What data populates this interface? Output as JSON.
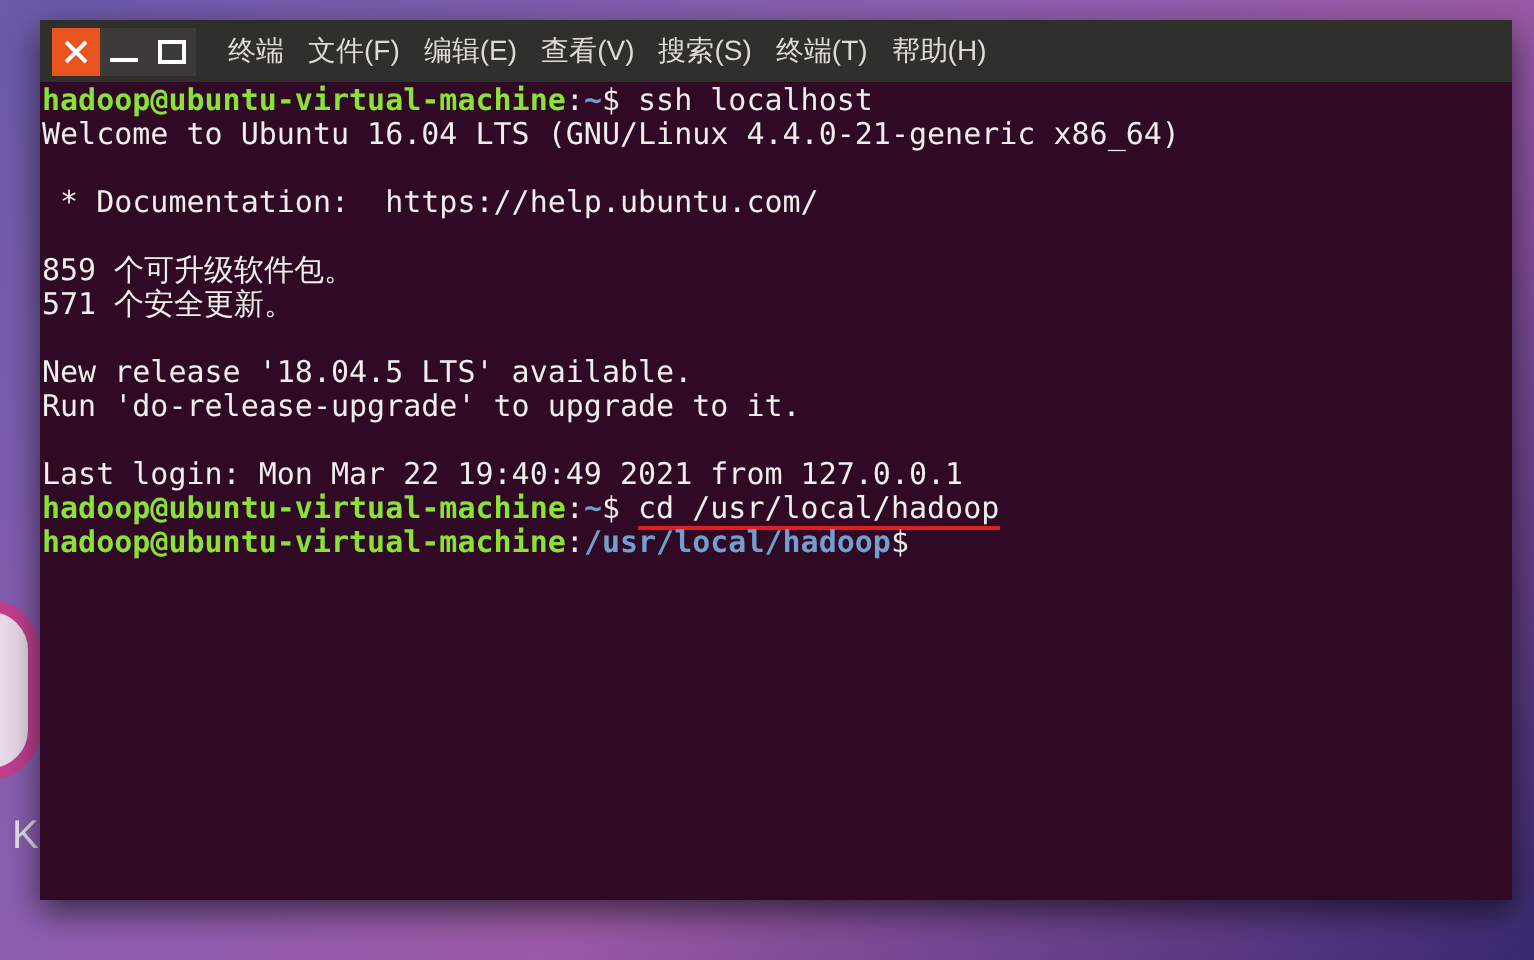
{
  "desktop": {
    "label": "K"
  },
  "window": {
    "menu": [
      "终端",
      "文件(F)",
      "编辑(E)",
      "查看(V)",
      "搜索(S)",
      "终端(T)",
      "帮助(H)"
    ]
  },
  "terminal": {
    "lines": [
      {
        "blank_before": false,
        "segments": [
          {
            "kind": "user",
            "text": "hadoop@ubuntu-virtual-machine"
          },
          {
            "kind": "plain",
            "text": ":"
          },
          {
            "kind": "path",
            "text": "~"
          },
          {
            "kind": "plain",
            "text": "$ ssh localhost"
          }
        ]
      },
      {
        "blank_before": false,
        "segments": [
          {
            "kind": "plain",
            "text": "Welcome to Ubuntu 16.04 LTS (GNU/Linux 4.4.0-21-generic x86_64)"
          }
        ]
      },
      {
        "blank_before": true,
        "segments": [
          {
            "kind": "plain",
            "text": " * Documentation:  https://help.ubuntu.com/"
          }
        ]
      },
      {
        "blank_before": true,
        "segments": [
          {
            "kind": "plain",
            "text": "859 个可升级软件包。"
          }
        ]
      },
      {
        "blank_before": false,
        "segments": [
          {
            "kind": "plain",
            "text": "571 个安全更新。"
          }
        ]
      },
      {
        "blank_before": true,
        "segments": [
          {
            "kind": "plain",
            "text": "New release '18.04.5 LTS' available."
          }
        ]
      },
      {
        "blank_before": false,
        "segments": [
          {
            "kind": "plain",
            "text": "Run 'do-release-upgrade' to upgrade to it."
          }
        ]
      },
      {
        "blank_before": true,
        "segments": [
          {
            "kind": "plain",
            "text": "Last login: Mon Mar 22 19:40:49 2021 from 127.0.0.1"
          }
        ]
      },
      {
        "blank_before": false,
        "segments": [
          {
            "kind": "user",
            "text": "hadoop@ubuntu-virtual-machine"
          },
          {
            "kind": "plain",
            "text": ":"
          },
          {
            "kind": "path",
            "text": "~"
          },
          {
            "kind": "plain",
            "text": "$ "
          },
          {
            "kind": "marked",
            "text": "cd /usr/local/hadoop"
          }
        ]
      },
      {
        "blank_before": false,
        "segments": [
          {
            "kind": "user",
            "text": "hadoop@ubuntu-virtual-machine"
          },
          {
            "kind": "plain",
            "text": ":"
          },
          {
            "kind": "path",
            "text": "/usr/local/hadoop"
          },
          {
            "kind": "plain",
            "text": "$"
          }
        ]
      }
    ]
  }
}
